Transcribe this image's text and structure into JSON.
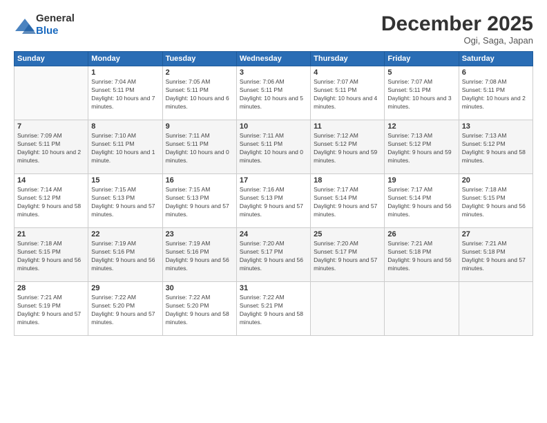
{
  "logo": {
    "general": "General",
    "blue": "Blue"
  },
  "title": "December 2025",
  "location": "Ogi, Saga, Japan",
  "days_header": [
    "Sunday",
    "Monday",
    "Tuesday",
    "Wednesday",
    "Thursday",
    "Friday",
    "Saturday"
  ],
  "weeks": [
    [
      {
        "day": "",
        "sunrise": "",
        "sunset": "",
        "daylight": ""
      },
      {
        "day": "1",
        "sunrise": "Sunrise: 7:04 AM",
        "sunset": "Sunset: 5:11 PM",
        "daylight": "Daylight: 10 hours and 7 minutes."
      },
      {
        "day": "2",
        "sunrise": "Sunrise: 7:05 AM",
        "sunset": "Sunset: 5:11 PM",
        "daylight": "Daylight: 10 hours and 6 minutes."
      },
      {
        "day": "3",
        "sunrise": "Sunrise: 7:06 AM",
        "sunset": "Sunset: 5:11 PM",
        "daylight": "Daylight: 10 hours and 5 minutes."
      },
      {
        "day": "4",
        "sunrise": "Sunrise: 7:07 AM",
        "sunset": "Sunset: 5:11 PM",
        "daylight": "Daylight: 10 hours and 4 minutes."
      },
      {
        "day": "5",
        "sunrise": "Sunrise: 7:07 AM",
        "sunset": "Sunset: 5:11 PM",
        "daylight": "Daylight: 10 hours and 3 minutes."
      },
      {
        "day": "6",
        "sunrise": "Sunrise: 7:08 AM",
        "sunset": "Sunset: 5:11 PM",
        "daylight": "Daylight: 10 hours and 2 minutes."
      }
    ],
    [
      {
        "day": "7",
        "sunrise": "Sunrise: 7:09 AM",
        "sunset": "Sunset: 5:11 PM",
        "daylight": "Daylight: 10 hours and 2 minutes."
      },
      {
        "day": "8",
        "sunrise": "Sunrise: 7:10 AM",
        "sunset": "Sunset: 5:11 PM",
        "daylight": "Daylight: 10 hours and 1 minute."
      },
      {
        "day": "9",
        "sunrise": "Sunrise: 7:11 AM",
        "sunset": "Sunset: 5:11 PM",
        "daylight": "Daylight: 10 hours and 0 minutes."
      },
      {
        "day": "10",
        "sunrise": "Sunrise: 7:11 AM",
        "sunset": "Sunset: 5:11 PM",
        "daylight": "Daylight: 10 hours and 0 minutes."
      },
      {
        "day": "11",
        "sunrise": "Sunrise: 7:12 AM",
        "sunset": "Sunset: 5:12 PM",
        "daylight": "Daylight: 9 hours and 59 minutes."
      },
      {
        "day": "12",
        "sunrise": "Sunrise: 7:13 AM",
        "sunset": "Sunset: 5:12 PM",
        "daylight": "Daylight: 9 hours and 59 minutes."
      },
      {
        "day": "13",
        "sunrise": "Sunrise: 7:13 AM",
        "sunset": "Sunset: 5:12 PM",
        "daylight": "Daylight: 9 hours and 58 minutes."
      }
    ],
    [
      {
        "day": "14",
        "sunrise": "Sunrise: 7:14 AM",
        "sunset": "Sunset: 5:12 PM",
        "daylight": "Daylight: 9 hours and 58 minutes."
      },
      {
        "day": "15",
        "sunrise": "Sunrise: 7:15 AM",
        "sunset": "Sunset: 5:13 PM",
        "daylight": "Daylight: 9 hours and 57 minutes."
      },
      {
        "day": "16",
        "sunrise": "Sunrise: 7:15 AM",
        "sunset": "Sunset: 5:13 PM",
        "daylight": "Daylight: 9 hours and 57 minutes."
      },
      {
        "day": "17",
        "sunrise": "Sunrise: 7:16 AM",
        "sunset": "Sunset: 5:13 PM",
        "daylight": "Daylight: 9 hours and 57 minutes."
      },
      {
        "day": "18",
        "sunrise": "Sunrise: 7:17 AM",
        "sunset": "Sunset: 5:14 PM",
        "daylight": "Daylight: 9 hours and 57 minutes."
      },
      {
        "day": "19",
        "sunrise": "Sunrise: 7:17 AM",
        "sunset": "Sunset: 5:14 PM",
        "daylight": "Daylight: 9 hours and 56 minutes."
      },
      {
        "day": "20",
        "sunrise": "Sunrise: 7:18 AM",
        "sunset": "Sunset: 5:15 PM",
        "daylight": "Daylight: 9 hours and 56 minutes."
      }
    ],
    [
      {
        "day": "21",
        "sunrise": "Sunrise: 7:18 AM",
        "sunset": "Sunset: 5:15 PM",
        "daylight": "Daylight: 9 hours and 56 minutes."
      },
      {
        "day": "22",
        "sunrise": "Sunrise: 7:19 AM",
        "sunset": "Sunset: 5:16 PM",
        "daylight": "Daylight: 9 hours and 56 minutes."
      },
      {
        "day": "23",
        "sunrise": "Sunrise: 7:19 AM",
        "sunset": "Sunset: 5:16 PM",
        "daylight": "Daylight: 9 hours and 56 minutes."
      },
      {
        "day": "24",
        "sunrise": "Sunrise: 7:20 AM",
        "sunset": "Sunset: 5:17 PM",
        "daylight": "Daylight: 9 hours and 56 minutes."
      },
      {
        "day": "25",
        "sunrise": "Sunrise: 7:20 AM",
        "sunset": "Sunset: 5:17 PM",
        "daylight": "Daylight: 9 hours and 57 minutes."
      },
      {
        "day": "26",
        "sunrise": "Sunrise: 7:21 AM",
        "sunset": "Sunset: 5:18 PM",
        "daylight": "Daylight: 9 hours and 56 minutes."
      },
      {
        "day": "27",
        "sunrise": "Sunrise: 7:21 AM",
        "sunset": "Sunset: 5:18 PM",
        "daylight": "Daylight: 9 hours and 57 minutes."
      }
    ],
    [
      {
        "day": "28",
        "sunrise": "Sunrise: 7:21 AM",
        "sunset": "Sunset: 5:19 PM",
        "daylight": "Daylight: 9 hours and 57 minutes."
      },
      {
        "day": "29",
        "sunrise": "Sunrise: 7:22 AM",
        "sunset": "Sunset: 5:20 PM",
        "daylight": "Daylight: 9 hours and 57 minutes."
      },
      {
        "day": "30",
        "sunrise": "Sunrise: 7:22 AM",
        "sunset": "Sunset: 5:20 PM",
        "daylight": "Daylight: 9 hours and 58 minutes."
      },
      {
        "day": "31",
        "sunrise": "Sunrise: 7:22 AM",
        "sunset": "Sunset: 5:21 PM",
        "daylight": "Daylight: 9 hours and 58 minutes."
      },
      {
        "day": "",
        "sunrise": "",
        "sunset": "",
        "daylight": ""
      },
      {
        "day": "",
        "sunrise": "",
        "sunset": "",
        "daylight": ""
      },
      {
        "day": "",
        "sunrise": "",
        "sunset": "",
        "daylight": ""
      }
    ]
  ]
}
